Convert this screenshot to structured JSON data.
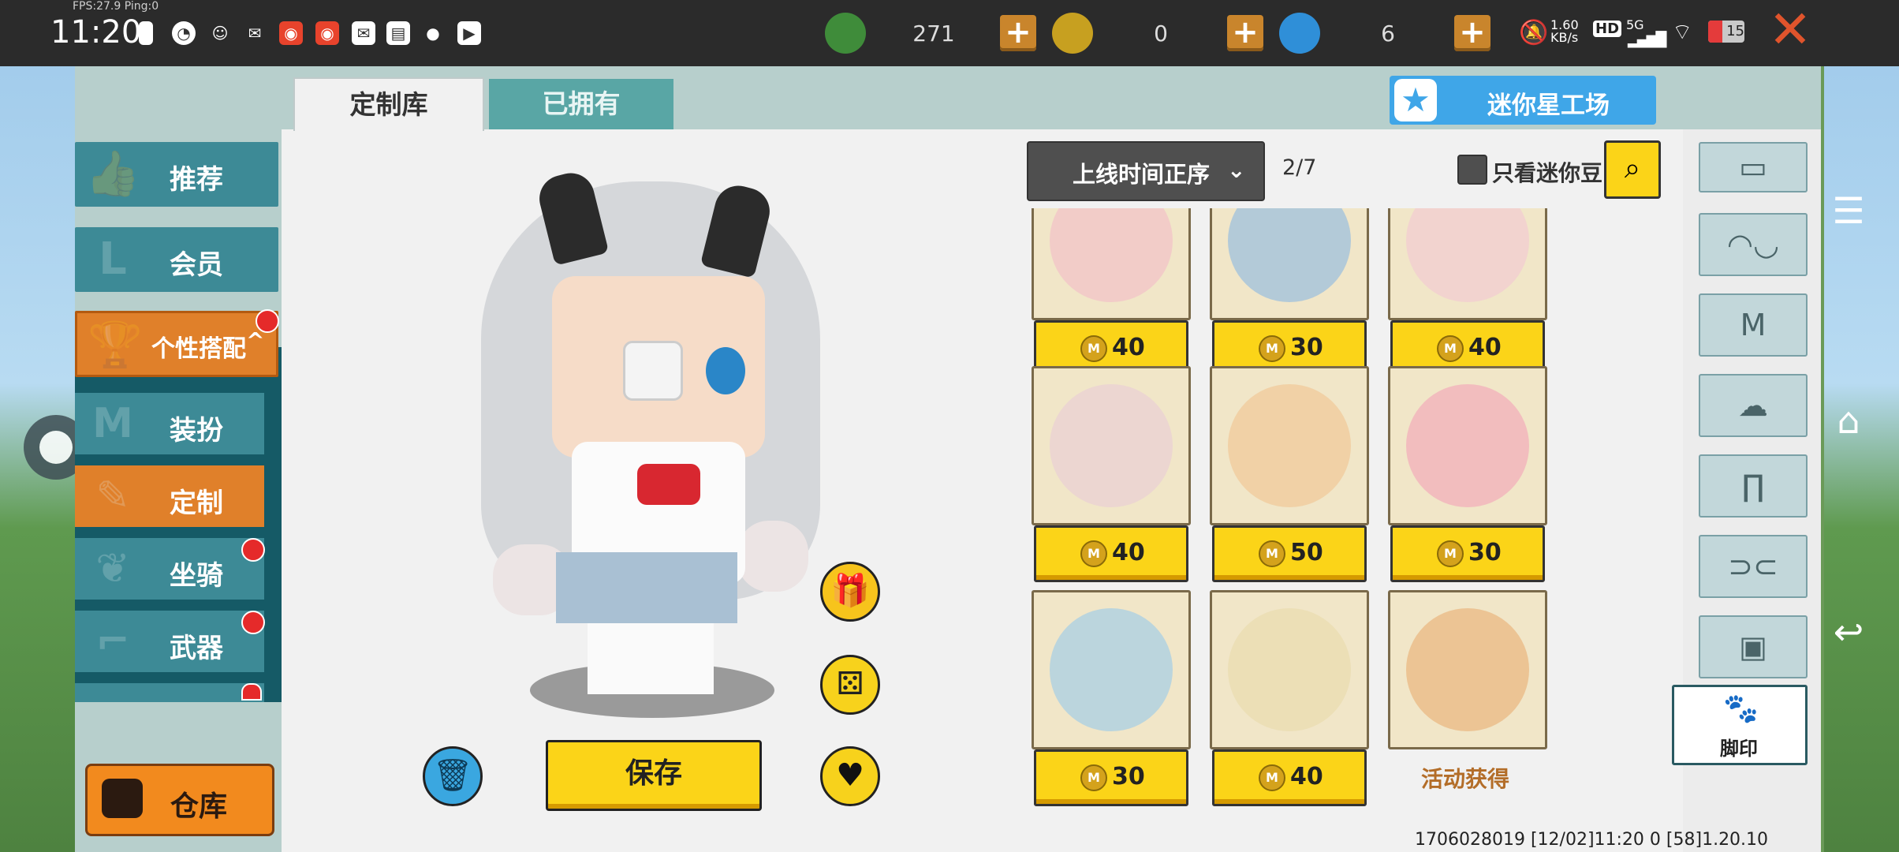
{
  "status_bar": {
    "time": "11:20",
    "fps": "FPS:27.9  Ping:0",
    "currencies": [
      {
        "icon": "green-gem-icon",
        "value": "271"
      },
      {
        "icon": "gold-coin-icon",
        "value": "0"
      },
      {
        "icon": "blue-coin-icon",
        "value": "6"
      }
    ],
    "net_speed": "1.60\nKB/s",
    "battery": "15",
    "hd": "HD",
    "signal": "5G"
  },
  "tabs": {
    "custom": "定制库",
    "owned": "已拥有"
  },
  "workshop_label": "迷你星工场",
  "left_menu": {
    "recommend": "推荐",
    "member": "会员",
    "personal": "个性搭配",
    "dress": "装扮",
    "custom": "定制",
    "mount": "坐骑",
    "weapon": "武器",
    "storage": "仓库"
  },
  "controls": {
    "sort_label": "上线时间正序",
    "page": "2/7",
    "only_mini_beans": "只看迷你豆"
  },
  "save_label": "保存",
  "items": [
    {
      "price": "40",
      "art": "#f3b7c9"
    },
    {
      "price": "30",
      "art": "#7fb3e6"
    },
    {
      "price": "40",
      "art": "#f3c2d6"
    },
    {
      "price": "40",
      "art": "#e8c9d8"
    },
    {
      "price": "50",
      "art": "#f0c08a"
    },
    {
      "price": "30",
      "art": "#f29ab6"
    },
    {
      "price": "30",
      "art": "#8ec6ee"
    },
    {
      "price": "40",
      "art": "#e8d9a8"
    },
    {
      "price": "活动获得",
      "art": "#e8a86a",
      "event": true
    }
  ],
  "right_categories": [
    "face-icon",
    "mask-icon",
    "shirt-icon",
    "hair-icon",
    "pants-icon",
    "shoes-icon",
    "backpack-icon"
  ],
  "footprint_label": "脚印",
  "version": "1706028019   [12/02]11:20 0   [58]1.20.10"
}
